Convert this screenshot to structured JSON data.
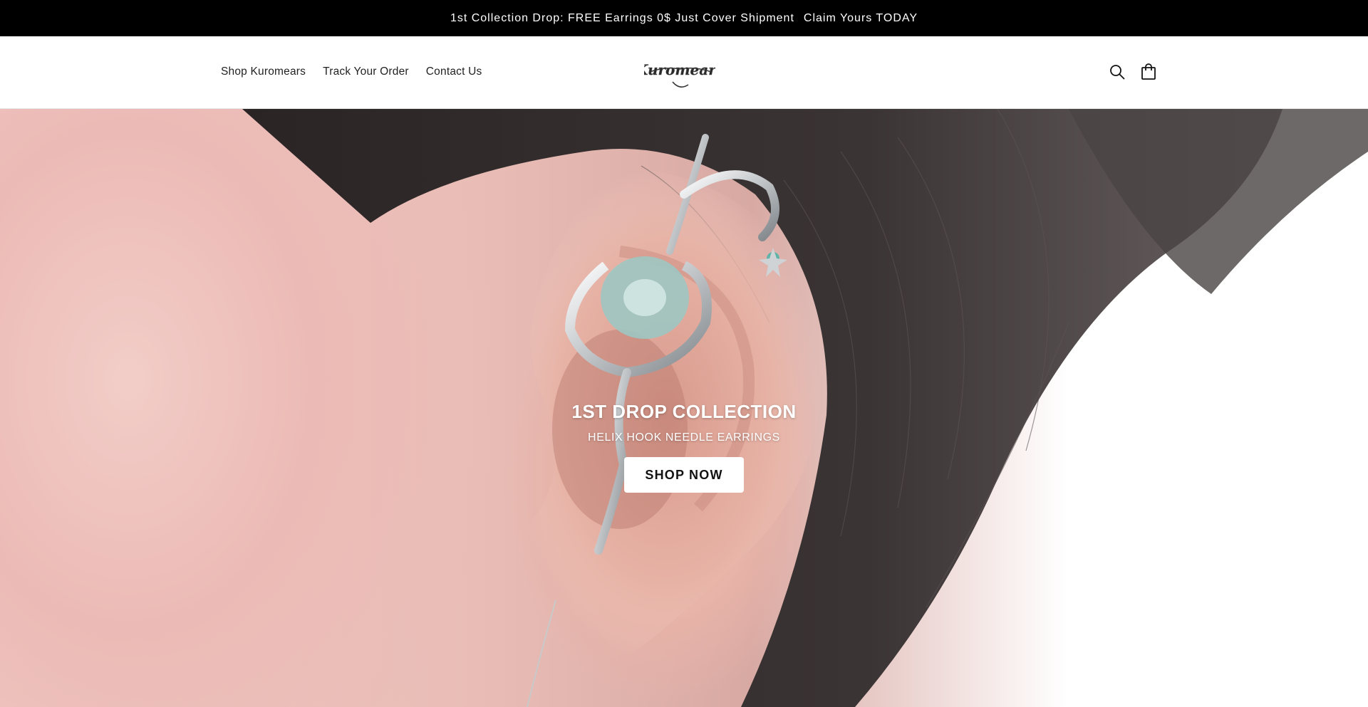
{
  "announcement": {
    "text": "1st Collection Drop: FREE Earrings 0$ Just Cover Shipment",
    "cta": "Claim Yours TODAY"
  },
  "header": {
    "nav": [
      {
        "label": "Shop Kuromears"
      },
      {
        "label": "Track Your Order"
      },
      {
        "label": "Contact Us"
      }
    ],
    "logo_text": "Kuromears",
    "icons": [
      "search-icon",
      "cart-icon"
    ]
  },
  "hero": {
    "title": "1ST DROP COLLECTION",
    "subtitle": "HELIX HOOK NEEDLE EARRINGS",
    "button": "SHOP NOW"
  },
  "colors": {
    "announcement_bg": "#000000",
    "button_bg": "#ffffff",
    "text_dark": "#121212"
  }
}
